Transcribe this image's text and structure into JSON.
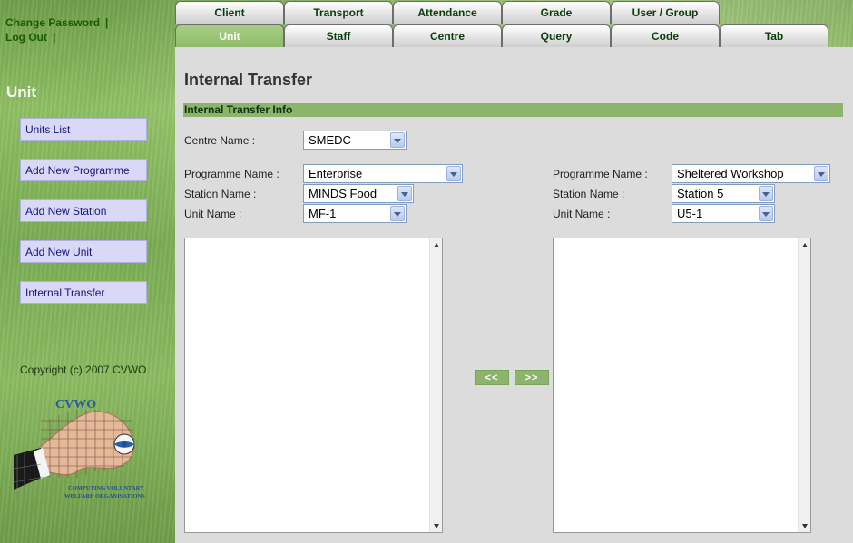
{
  "toplinks": {
    "change_password": "Change Password",
    "log_out": "Log Out",
    "separator": "|"
  },
  "tabs": {
    "row1": [
      "Client",
      "Transport",
      "Attendance",
      "Grade",
      "User / Group"
    ],
    "row2": [
      "Unit",
      "Staff",
      "Centre",
      "Query",
      "Code",
      "Tab"
    ],
    "active": "Unit"
  },
  "sidebar": {
    "title": "Unit",
    "items": [
      "Units List",
      "Add New Programme",
      "Add New Station",
      "Add New Unit",
      "Internal Transfer"
    ],
    "copyright": "Copyright (c) 2007 CVWO",
    "logo_text": "CVWO",
    "logo_caption_1": "COMPUTING VOLUNTARY",
    "logo_caption_2": "WELFARE ORGANISATIONS"
  },
  "main": {
    "title": "Internal Transfer",
    "section": "Internal Transfer Info",
    "centre_label": "Centre Name :",
    "centre_value": "SMEDC",
    "left": {
      "programme_label": "Programme Name :",
      "programme_value": "Enterprise",
      "station_label": "Station Name :",
      "station_value": "MINDS Food",
      "unit_label": "Unit Name :",
      "unit_value": "MF-1"
    },
    "right": {
      "programme_label": "Programme Name :",
      "programme_value": "Sheltered Workshop",
      "station_label": "Station Name :",
      "station_value": "Station 5",
      "unit_label": "Unit Name :",
      "unit_value": "U5-1"
    },
    "move_left": "<<",
    "move_right": ">>"
  },
  "colors": {
    "accent_green": "#8cb46b",
    "sidebar_button": "#d9d9f7",
    "active_tab_text": "#ffffff"
  }
}
